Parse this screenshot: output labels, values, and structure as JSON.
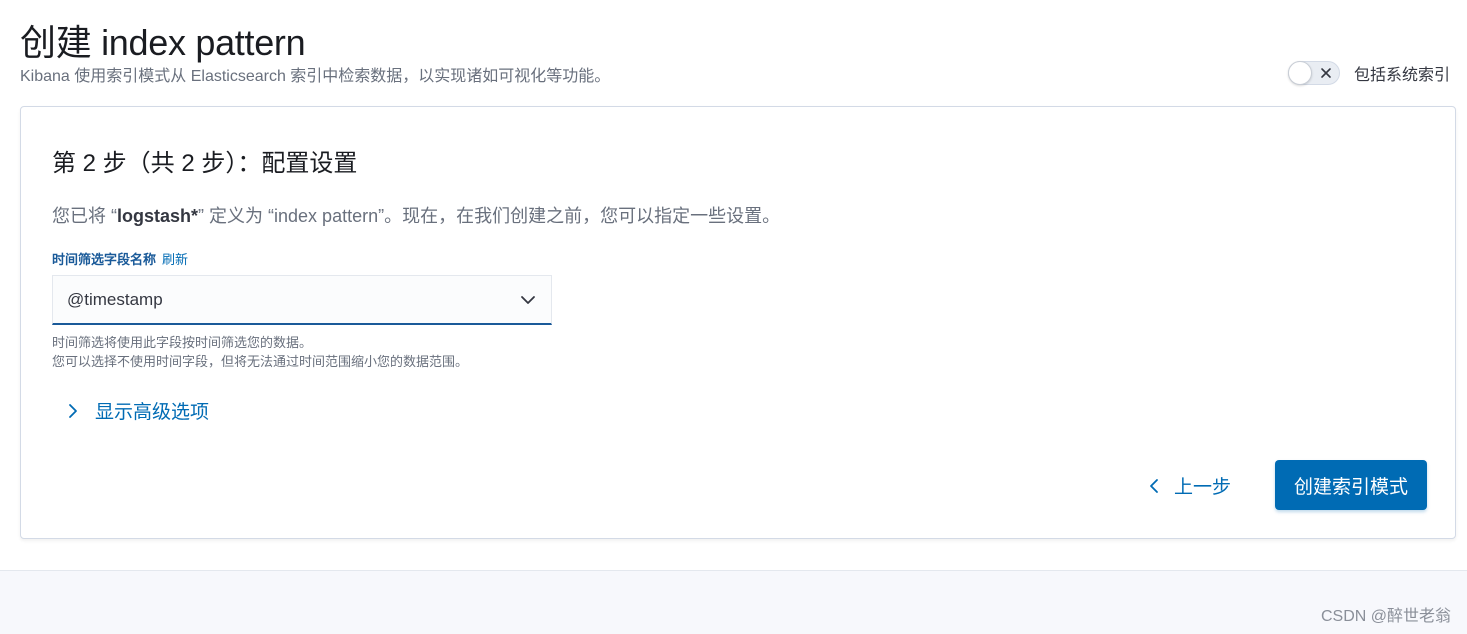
{
  "header": {
    "title": "创建 index pattern",
    "description": "Kibana 使用索引模式从 Elasticsearch 索引中检索数据，以实现诸如可视化等功能。",
    "toggle_label": "包括系统索引",
    "toggle_state": "off"
  },
  "step": {
    "title": "第 2 步（共 2 步）：配置设置",
    "intro_before": "您已将 “",
    "intro_pattern": "logstash*",
    "intro_after": "” 定义为 “index pattern”。现在，在我们创建之前，您可以指定一些设置。"
  },
  "time_field": {
    "label": "时间筛选字段名称",
    "refresh_label": "刷新",
    "selected_value": "@timestamp",
    "help_line1": "时间筛选将使用此字段按时间筛选您的数据。",
    "help_line2": "您可以选择不使用时间字段，但将无法通过时间范围缩小您的数据范围。"
  },
  "advanced_options_label": "显示高级选项",
  "actions": {
    "back_label": "上一步",
    "create_label": "创建索引模式"
  },
  "watermark": "CSDN @醉世老翁",
  "colors": {
    "accent": "#006bb4",
    "title": "#1a1c21",
    "subdued_text": "#69707d",
    "label_blue": "#1a5a99"
  },
  "icons": [
    "close-icon",
    "chevron-down-icon",
    "chevron-right-icon",
    "chevron-left-icon"
  ]
}
